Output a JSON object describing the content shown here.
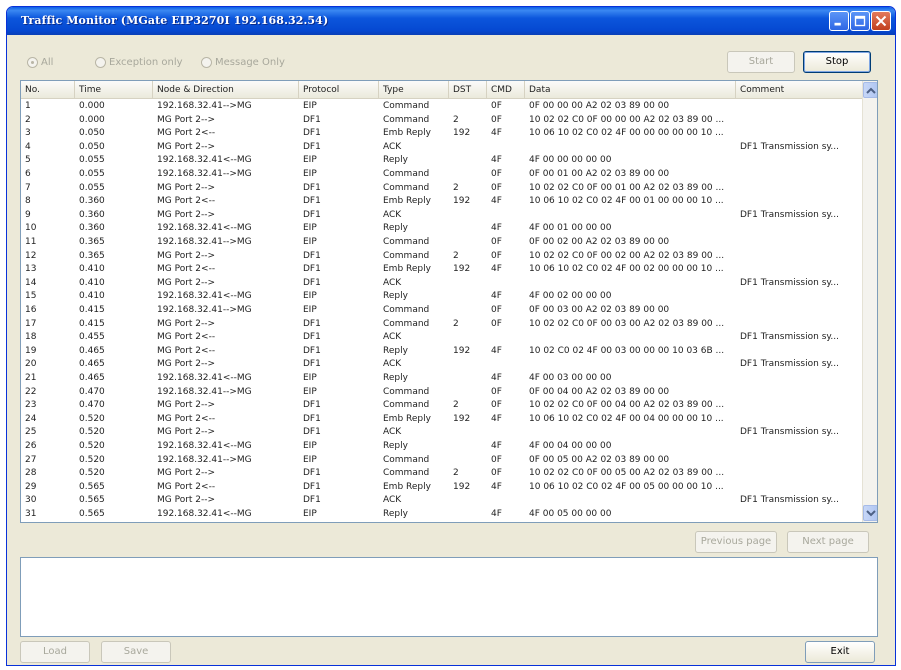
{
  "window": {
    "title": "Traffic Monitor (MGate EIP3270I 192.168.32.54)"
  },
  "filters": [
    {
      "label": "All",
      "selected": true
    },
    {
      "label": "Exception only",
      "selected": false
    },
    {
      "label": "Message Only",
      "selected": false
    }
  ],
  "buttons": {
    "start": "Start",
    "stop": "Stop",
    "previous_page": "Previous page",
    "next_page": "Next page",
    "load": "Load",
    "save": "Save",
    "exit": "Exit"
  },
  "table": {
    "columns": [
      "No.",
      "Time",
      "Node & Direction",
      "Protocol",
      "Type",
      "DST",
      "CMD",
      "Data",
      "Comment"
    ],
    "rows": [
      [
        "1",
        "0.000",
        "192.168.32.41-->MG",
        "EIP",
        "Command",
        "",
        "0F",
        "0F 00 00 00 A2 02 03 89 00 00",
        ""
      ],
      [
        "2",
        "0.000",
        "MG Port 2-->",
        "DF1",
        "Command",
        "2",
        "0F",
        "10 02 02 C0 0F 00 00 00 A2 02 03 89 00 ...",
        ""
      ],
      [
        "3",
        "0.050",
        "MG Port 2<--",
        "DF1",
        "Emb Reply",
        "192",
        "4F",
        "10 06 10 02 C0 02 4F 00 00 00 00 00 10 ...",
        ""
      ],
      [
        "4",
        "0.050",
        "MG Port 2-->",
        "DF1",
        "ACK",
        "",
        "",
        "",
        "DF1 Transmission sy..."
      ],
      [
        "5",
        "0.055",
        "192.168.32.41<--MG",
        "EIP",
        "Reply",
        "",
        "4F",
        "4F 00 00 00 00 00",
        ""
      ],
      [
        "6",
        "0.055",
        "192.168.32.41-->MG",
        "EIP",
        "Command",
        "",
        "0F",
        "0F 00 01 00 A2 02 03 89 00 00",
        ""
      ],
      [
        "7",
        "0.055",
        "MG Port 2-->",
        "DF1",
        "Command",
        "2",
        "0F",
        "10 02 02 C0 0F 00 01 00 A2 02 03 89 00 ...",
        ""
      ],
      [
        "8",
        "0.360",
        "MG Port 2<--",
        "DF1",
        "Emb Reply",
        "192",
        "4F",
        "10 06 10 02 C0 02 4F 00 01 00 00 00 10 ...",
        ""
      ],
      [
        "9",
        "0.360",
        "MG Port 2-->",
        "DF1",
        "ACK",
        "",
        "",
        "",
        "DF1 Transmission sy..."
      ],
      [
        "10",
        "0.360",
        "192.168.32.41<--MG",
        "EIP",
        "Reply",
        "",
        "4F",
        "4F 00 01 00 00 00",
        ""
      ],
      [
        "11",
        "0.365",
        "192.168.32.41-->MG",
        "EIP",
        "Command",
        "",
        "0F",
        "0F 00 02 00 A2 02 03 89 00 00",
        ""
      ],
      [
        "12",
        "0.365",
        "MG Port 2-->",
        "DF1",
        "Command",
        "2",
        "0F",
        "10 02 02 C0 0F 00 02 00 A2 02 03 89 00 ...",
        ""
      ],
      [
        "13",
        "0.410",
        "MG Port 2<--",
        "DF1",
        "Emb Reply",
        "192",
        "4F",
        "10 06 10 02 C0 02 4F 00 02 00 00 00 10 ...",
        ""
      ],
      [
        "14",
        "0.410",
        "MG Port 2-->",
        "DF1",
        "ACK",
        "",
        "",
        "",
        "DF1 Transmission sy..."
      ],
      [
        "15",
        "0.410",
        "192.168.32.41<--MG",
        "EIP",
        "Reply",
        "",
        "4F",
        "4F 00 02 00 00 00",
        ""
      ],
      [
        "16",
        "0.415",
        "192.168.32.41-->MG",
        "EIP",
        "Command",
        "",
        "0F",
        "0F 00 03 00 A2 02 03 89 00 00",
        ""
      ],
      [
        "17",
        "0.415",
        "MG Port 2-->",
        "DF1",
        "Command",
        "2",
        "0F",
        "10 02 02 C0 0F 00 03 00 A2 02 03 89 00 ...",
        ""
      ],
      [
        "18",
        "0.455",
        "MG Port 2<--",
        "DF1",
        "ACK",
        "",
        "",
        "",
        "DF1 Transmission sy..."
      ],
      [
        "19",
        "0.465",
        "MG Port 2<--",
        "DF1",
        "Reply",
        "192",
        "4F",
        "10 02 C0 02 4F 00 03 00 00 00 10 03 6B ...",
        ""
      ],
      [
        "20",
        "0.465",
        "MG Port 2-->",
        "DF1",
        "ACK",
        "",
        "",
        "",
        "DF1 Transmission sy..."
      ],
      [
        "21",
        "0.465",
        "192.168.32.41<--MG",
        "EIP",
        "Reply",
        "",
        "4F",
        "4F 00 03 00 00 00",
        ""
      ],
      [
        "22",
        "0.470",
        "192.168.32.41-->MG",
        "EIP",
        "Command",
        "",
        "0F",
        "0F 00 04 00 A2 02 03 89 00 00",
        ""
      ],
      [
        "23",
        "0.470",
        "MG Port 2-->",
        "DF1",
        "Command",
        "2",
        "0F",
        "10 02 02 C0 0F 00 04 00 A2 02 03 89 00 ...",
        ""
      ],
      [
        "24",
        "0.520",
        "MG Port 2<--",
        "DF1",
        "Emb Reply",
        "192",
        "4F",
        "10 06 10 02 C0 02 4F 00 04 00 00 00 10 ...",
        ""
      ],
      [
        "25",
        "0.520",
        "MG Port 2-->",
        "DF1",
        "ACK",
        "",
        "",
        "",
        "DF1 Transmission sy..."
      ],
      [
        "26",
        "0.520",
        "192.168.32.41<--MG",
        "EIP",
        "Reply",
        "",
        "4F",
        "4F 00 04 00 00 00",
        ""
      ],
      [
        "27",
        "0.520",
        "192.168.32.41-->MG",
        "EIP",
        "Command",
        "",
        "0F",
        "0F 00 05 00 A2 02 03 89 00 00",
        ""
      ],
      [
        "28",
        "0.520",
        "MG Port 2-->",
        "DF1",
        "Command",
        "2",
        "0F",
        "10 02 02 C0 0F 00 05 00 A2 02 03 89 00 ...",
        ""
      ],
      [
        "29",
        "0.565",
        "MG Port 2<--",
        "DF1",
        "Emb Reply",
        "192",
        "4F",
        "10 06 10 02 C0 02 4F 00 05 00 00 00 10 ...",
        ""
      ],
      [
        "30",
        "0.565",
        "MG Port 2-->",
        "DF1",
        "ACK",
        "",
        "",
        "",
        "DF1 Transmission sy..."
      ],
      [
        "31",
        "0.565",
        "192.168.32.41<--MG",
        "EIP",
        "Reply",
        "",
        "4F",
        "4F 00 05 00 00 00",
        ""
      ]
    ]
  },
  "colors": {
    "title_bar": "#0c56dc",
    "window_bg": "#ece9d8",
    "table_border": "#7f9db9"
  }
}
